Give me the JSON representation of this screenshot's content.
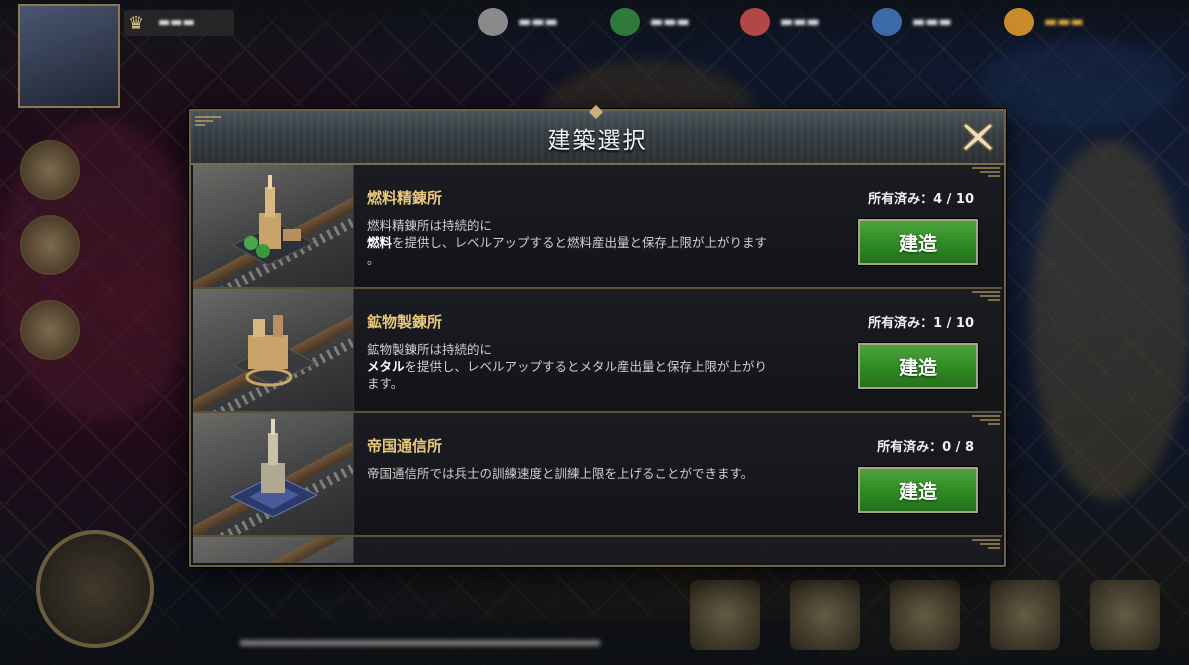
{
  "modal": {
    "title": "建築選択",
    "buildings": [
      {
        "name": "燃料精錬所",
        "owned": "所有済み：4 / 10",
        "desc_line1": "燃料精錬所は持続的に",
        "desc_bold": "燃料",
        "desc_line2": "を提供し、レベルアップすると燃料産出量と保存上限が上がります",
        "desc_line3": "。",
        "button": "建造"
      },
      {
        "name": "鉱物製錬所",
        "owned": "所有済み：1 / 10",
        "desc_line1": "鉱物製錬所は持続的に",
        "desc_bold": "メタル",
        "desc_line2": "を提供し、レベルアップするとメタル産出量と保存上限が上がり",
        "desc_line3": "ます。",
        "button": "建造"
      },
      {
        "name": "帝国通信所",
        "owned": "所有済み：0 / 8",
        "desc_line1": "帝国通信所では兵士の訓練速度と訓練上限を上げることができます。",
        "desc_bold": "",
        "desc_line2": "",
        "desc_line3": "",
        "button": "建造"
      }
    ]
  },
  "colors": {
    "accent_gold": "#e8c87a",
    "button_green": "#2f8a24",
    "frame": "#6f624a"
  },
  "icons": {
    "close": "close-x-icon",
    "power": "helmet-icon",
    "resources": [
      "fuel-icon",
      "metal-icon",
      "gold-icon",
      "food-icon",
      "gem-icon"
    ]
  }
}
